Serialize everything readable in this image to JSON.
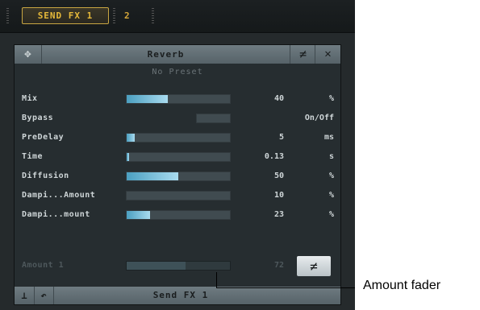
{
  "topbar": {
    "tabs": [
      {
        "label": "SEND FX 1",
        "active": true
      },
      {
        "label": "2",
        "active": false
      }
    ]
  },
  "plugin": {
    "title": "Reverb",
    "preset": "No Preset",
    "move_icon": "move-arrows-icon",
    "bypass_icon": "bypass-icon",
    "close_icon": "close-icon",
    "params": [
      {
        "label": "Mix",
        "value": "40",
        "unit": "%",
        "level": 0.4
      },
      {
        "label": "Bypass",
        "value": "",
        "unit": "On/Off",
        "level": null
      },
      {
        "label": "PreDelay",
        "value": "5",
        "unit": "ms",
        "level": 0.08
      },
      {
        "label": "Time",
        "value": "0.13",
        "unit": "s",
        "level": 0.02
      },
      {
        "label": "Diffusion",
        "value": "50",
        "unit": "%",
        "level": 0.5
      },
      {
        "label": "Dampi...Amount",
        "value": "10",
        "unit": "%",
        "level": 0.0
      },
      {
        "label": "Dampi...mount",
        "value": "23",
        "unit": "%",
        "level": 0.23
      }
    ],
    "amount": {
      "label": "Amount 1",
      "value": "72",
      "level": 0.57
    },
    "footer": {
      "name": "Send FX 1",
      "icons": [
        "route-icon",
        "undo-icon"
      ]
    }
  },
  "callout": {
    "text": "Amount fader"
  },
  "colors": {
    "accent": "#e6b93a",
    "fill": "#7ec3df",
    "panel": "#262d30"
  }
}
